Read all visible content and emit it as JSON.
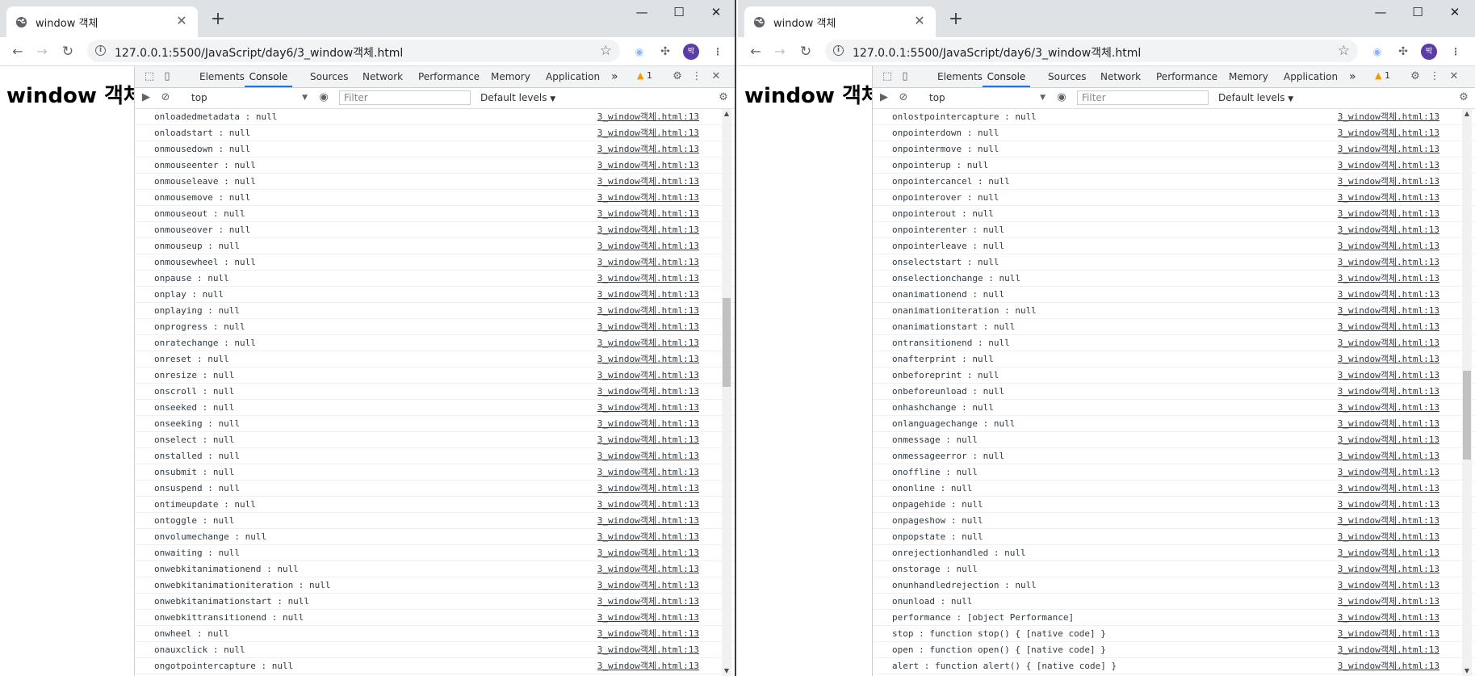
{
  "left": {
    "tab_title": "window 객체",
    "url": "127.0.0.1:5500/JavaScript/day6/3_window객체.html",
    "page_heading": "window 객체",
    "devtools": {
      "tabs": [
        "Elements",
        "Console",
        "Sources",
        "Network",
        "Performance",
        "Memory",
        "Application"
      ],
      "active_tab": "Console",
      "more": "»",
      "warning_count": "1",
      "context": "top",
      "filter_placeholder": "Filter",
      "levels": "Default levels"
    },
    "scroll_position": 0.39,
    "logs": [
      {
        "msg": "onloadedmetadata : null",
        "src": "3_window객체.html:13"
      },
      {
        "msg": "onloadstart : null",
        "src": "3_window객체.html:13"
      },
      {
        "msg": "onmousedown : null",
        "src": "3_window객체.html:13"
      },
      {
        "msg": "onmouseenter : null",
        "src": "3_window객체.html:13"
      },
      {
        "msg": "onmouseleave : null",
        "src": "3_window객체.html:13"
      },
      {
        "msg": "onmousemove : null",
        "src": "3_window객체.html:13"
      },
      {
        "msg": "onmouseout : null",
        "src": "3_window객체.html:13"
      },
      {
        "msg": "onmouseover : null",
        "src": "3_window객체.html:13"
      },
      {
        "msg": "onmouseup : null",
        "src": "3_window객체.html:13"
      },
      {
        "msg": "onmousewheel : null",
        "src": "3_window객체.html:13"
      },
      {
        "msg": "onpause : null",
        "src": "3_window객체.html:13"
      },
      {
        "msg": "onplay : null",
        "src": "3_window객체.html:13"
      },
      {
        "msg": "onplaying : null",
        "src": "3_window객체.html:13"
      },
      {
        "msg": "onprogress : null",
        "src": "3_window객체.html:13"
      },
      {
        "msg": "onratechange : null",
        "src": "3_window객체.html:13"
      },
      {
        "msg": "onreset : null",
        "src": "3_window객체.html:13"
      },
      {
        "msg": "onresize : null",
        "src": "3_window객체.html:13"
      },
      {
        "msg": "onscroll : null",
        "src": "3_window객체.html:13"
      },
      {
        "msg": "onseeked : null",
        "src": "3_window객체.html:13"
      },
      {
        "msg": "onseeking : null",
        "src": "3_window객체.html:13"
      },
      {
        "msg": "onselect : null",
        "src": "3_window객체.html:13"
      },
      {
        "msg": "onstalled : null",
        "src": "3_window객체.html:13"
      },
      {
        "msg": "onsubmit : null",
        "src": "3_window객체.html:13"
      },
      {
        "msg": "onsuspend : null",
        "src": "3_window객체.html:13"
      },
      {
        "msg": "ontimeupdate : null",
        "src": "3_window객체.html:13"
      },
      {
        "msg": "ontoggle : null",
        "src": "3_window객체.html:13"
      },
      {
        "msg": "onvolumechange : null",
        "src": "3_window객체.html:13"
      },
      {
        "msg": "onwaiting : null",
        "src": "3_window객체.html:13"
      },
      {
        "msg": "onwebkitanimationend : null",
        "src": "3_window객체.html:13"
      },
      {
        "msg": "onwebkitanimationiteration : null",
        "src": "3_window객체.html:13"
      },
      {
        "msg": "onwebkitanimationstart : null",
        "src": "3_window객체.html:13"
      },
      {
        "msg": "onwebkittransitionend : null",
        "src": "3_window객체.html:13"
      },
      {
        "msg": "onwheel : null",
        "src": "3_window객체.html:13"
      },
      {
        "msg": "onauxclick : null",
        "src": "3_window객체.html:13"
      },
      {
        "msg": "ongotpointercapture : null",
        "src": "3_window객체.html:13"
      }
    ]
  },
  "right": {
    "tab_title": "window 객체",
    "url": "127.0.0.1:5500/JavaScript/day6/3_window객체.html",
    "page_heading": "window 객체",
    "devtools": {
      "tabs": [
        "Elements",
        "Console",
        "Sources",
        "Network",
        "Performance",
        "Memory",
        "Application"
      ],
      "active_tab": "Console",
      "more": "»",
      "warning_count": "1",
      "context": "top",
      "filter_placeholder": "Filter",
      "levels": "Default levels"
    },
    "scroll_position": 0.55,
    "logs": [
      {
        "msg": "onlostpointercapture : null",
        "src": "3_window객체.html:13"
      },
      {
        "msg": "onpointerdown : null",
        "src": "3_window객체.html:13"
      },
      {
        "msg": "onpointermove : null",
        "src": "3_window객체.html:13"
      },
      {
        "msg": "onpointerup : null",
        "src": "3_window객체.html:13"
      },
      {
        "msg": "onpointercancel : null",
        "src": "3_window객체.html:13"
      },
      {
        "msg": "onpointerover : null",
        "src": "3_window객체.html:13"
      },
      {
        "msg": "onpointerout : null",
        "src": "3_window객체.html:13"
      },
      {
        "msg": "onpointerenter : null",
        "src": "3_window객체.html:13"
      },
      {
        "msg": "onpointerleave : null",
        "src": "3_window객체.html:13"
      },
      {
        "msg": "onselectstart : null",
        "src": "3_window객체.html:13"
      },
      {
        "msg": "onselectionchange : null",
        "src": "3_window객체.html:13"
      },
      {
        "msg": "onanimationend : null",
        "src": "3_window객체.html:13"
      },
      {
        "msg": "onanimationiteration : null",
        "src": "3_window객체.html:13"
      },
      {
        "msg": "onanimationstart : null",
        "src": "3_window객체.html:13"
      },
      {
        "msg": "ontransitionend : null",
        "src": "3_window객체.html:13"
      },
      {
        "msg": "onafterprint : null",
        "src": "3_window객체.html:13"
      },
      {
        "msg": "onbeforeprint : null",
        "src": "3_window객체.html:13"
      },
      {
        "msg": "onbeforeunload : null",
        "src": "3_window객체.html:13"
      },
      {
        "msg": "onhashchange : null",
        "src": "3_window객체.html:13"
      },
      {
        "msg": "onlanguagechange : null",
        "src": "3_window객체.html:13"
      },
      {
        "msg": "onmessage : null",
        "src": "3_window객체.html:13"
      },
      {
        "msg": "onmessageerror : null",
        "src": "3_window객체.html:13"
      },
      {
        "msg": "onoffline : null",
        "src": "3_window객체.html:13"
      },
      {
        "msg": "ononline : null",
        "src": "3_window객체.html:13"
      },
      {
        "msg": "onpagehide : null",
        "src": "3_window객체.html:13"
      },
      {
        "msg": "onpageshow : null",
        "src": "3_window객체.html:13"
      },
      {
        "msg": "onpopstate : null",
        "src": "3_window객체.html:13"
      },
      {
        "msg": "onrejectionhandled : null",
        "src": "3_window객체.html:13"
      },
      {
        "msg": "onstorage : null",
        "src": "3_window객체.html:13"
      },
      {
        "msg": "onunhandledrejection : null",
        "src": "3_window객체.html:13"
      },
      {
        "msg": "onunload : null",
        "src": "3_window객체.html:13"
      },
      {
        "msg": "performance : [object Performance]",
        "src": "3_window객체.html:13"
      },
      {
        "msg": "stop : function stop() { [native code] }",
        "src": "3_window객체.html:13"
      },
      {
        "msg": "open : function open() { [native code] }",
        "src": "3_window객체.html:13"
      },
      {
        "msg": "alert : function alert() { [native code] }",
        "src": "3_window객체.html:13"
      }
    ]
  },
  "profile_initial": "박",
  "colors": {
    "accent": "#1a73e8",
    "avatar": "#5b3ba8",
    "warning": "#f29900"
  }
}
